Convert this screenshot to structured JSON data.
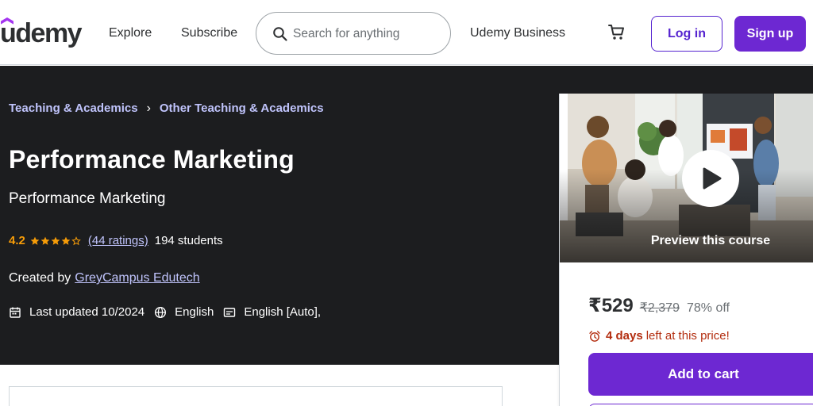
{
  "header": {
    "logo_text": "udemy",
    "explore_label": "Explore",
    "subscribe_label": "Subscribe",
    "search_placeholder": "Search for anything",
    "business_label": "Udemy Business",
    "login_label": "Log in",
    "signup_label": "Sign up"
  },
  "breadcrumb": {
    "items": [
      "Teaching & Academics",
      "Other Teaching & Academics"
    ],
    "separator": "›"
  },
  "course": {
    "title": "Performance Marketing",
    "subtitle": "Performance Marketing",
    "rating": "4.2",
    "rating_stars": 4.2,
    "ratings_count": "(44 ratings)",
    "students": "194 students",
    "created_by_label": "Created by",
    "instructor": "GreyCampus Edutech",
    "last_updated": "Last updated 10/2024",
    "language": "English",
    "captions": "English [Auto],"
  },
  "sidebar": {
    "preview_label": "Preview this course",
    "price": "₹529",
    "original_price": "₹2,379",
    "discount": "78% off",
    "timer_bold": "4 days",
    "timer_rest": "left at this price!",
    "add_to_cart_label": "Add to cart"
  },
  "colors": {
    "brand_purple": "#6d28d2",
    "link_purple": "#5624d0",
    "hero_bg": "#1c1d1f",
    "breadcrumb_link": "#c0c4fc",
    "rating_orange": "#f69c08",
    "timer_red": "#b32d0f"
  },
  "icons": {
    "search": "search-icon",
    "cart": "cart-icon",
    "calendar": "calendar-icon",
    "globe": "globe-icon",
    "captions": "captions-icon",
    "alarm": "alarm-icon",
    "play": "play-icon"
  }
}
